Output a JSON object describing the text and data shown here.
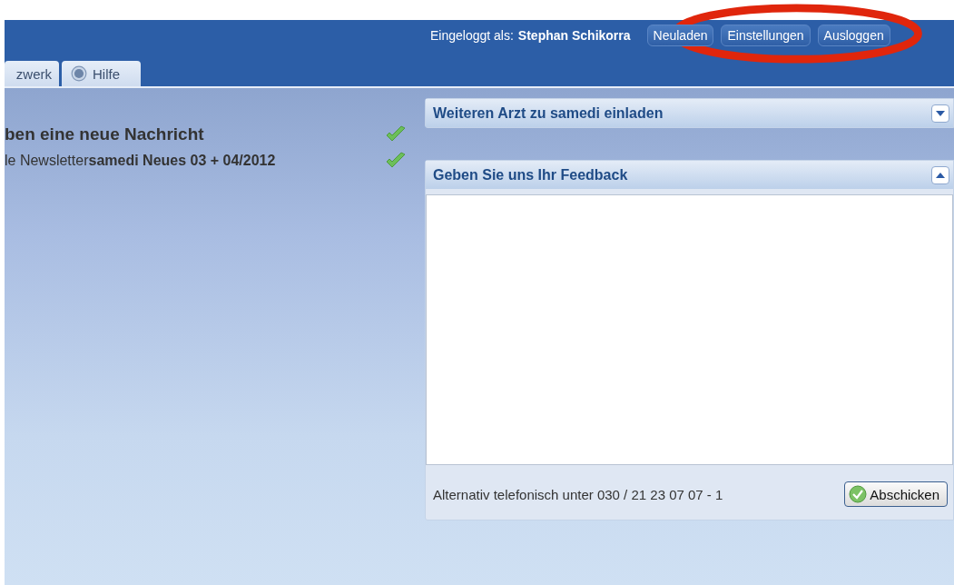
{
  "header": {
    "login_label": "Eingeloggt als:",
    "user": "Stephan Schikorra",
    "buttons": [
      "Neuladen",
      "Einstellungen",
      "Ausloggen"
    ]
  },
  "tabs": [
    {
      "label": "zwerk",
      "kind": "plain"
    },
    {
      "label": "Hilfe",
      "kind": "help"
    }
  ],
  "messages": [
    {
      "text": "ben eine neue Nachricht",
      "kind": "heading"
    },
    {
      "text": "le Newsletter**samedi Neues 03 + 04/2012**",
      "kind": "line"
    }
  ],
  "panels": [
    {
      "title": "Weiteren Arzt zu samedi einladen",
      "expanded": false
    },
    {
      "title": "Geben Sie uns Ihr Feedback",
      "expanded": true,
      "footer_text": "Alternativ telefonisch unter 030 / 21 23 07 07 - 1",
      "submit": "Abschicken"
    }
  ]
}
